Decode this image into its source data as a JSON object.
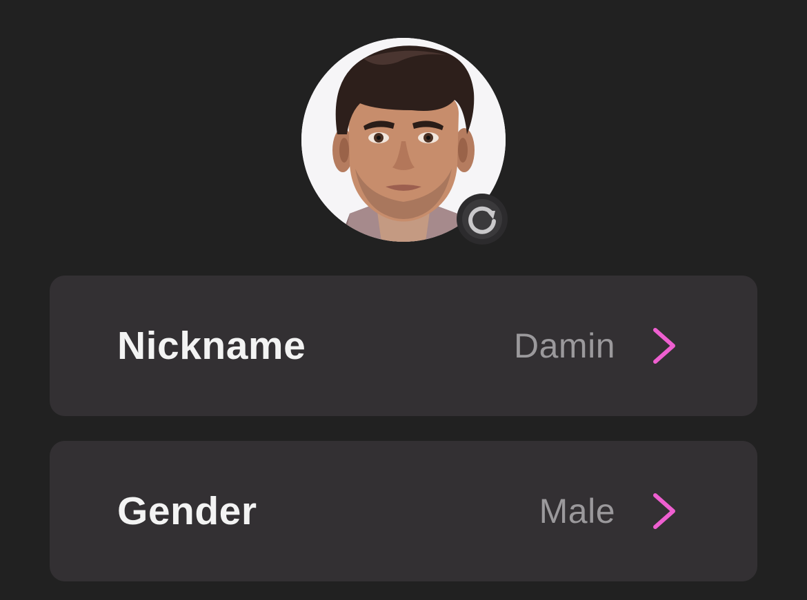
{
  "profile": {
    "avatar_icon": "user-avatar",
    "refresh_icon": "refresh-icon"
  },
  "settings": {
    "rows": [
      {
        "label": "Nickname",
        "value": "Damin",
        "chevron_icon": "chevron-right-icon"
      },
      {
        "label": "Gender",
        "value": "Male",
        "chevron_icon": "chevron-right-icon"
      }
    ]
  },
  "colors": {
    "background": "#212121",
    "card": "#333033",
    "label": "#f3f3f3",
    "value": "#9b999c",
    "accent": "#ee5fd0"
  }
}
